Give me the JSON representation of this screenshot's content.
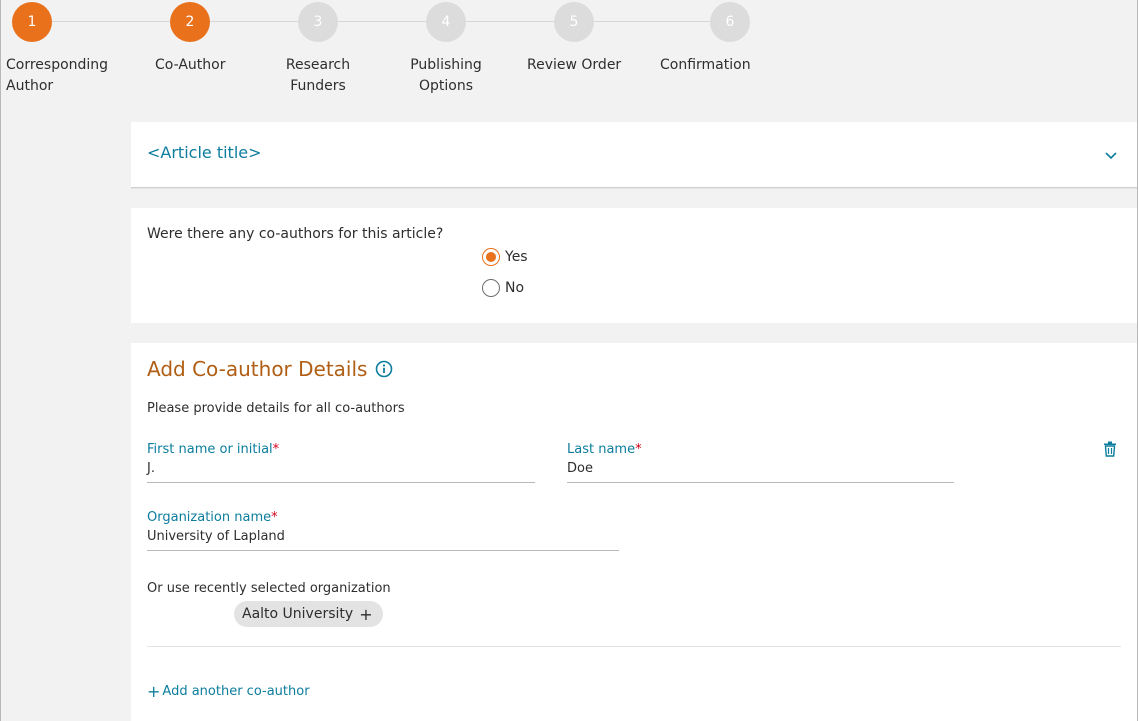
{
  "stepper": {
    "steps": [
      {
        "number": "1",
        "label_line1": "Corresponding",
        "label_line2": "Author"
      },
      {
        "number": "2",
        "label_line1": "Co-Author",
        "label_line2": ""
      },
      {
        "number": "3",
        "label_line1": "Research",
        "label_line2": "Funders"
      },
      {
        "number": "4",
        "label_line1": "Publishing",
        "label_line2": "Options"
      },
      {
        "number": "5",
        "label_line1": "Review Order",
        "label_line2": ""
      },
      {
        "number": "6",
        "label_line1": "Confirmation",
        "label_line2": ""
      }
    ],
    "active_color": "#e9711c",
    "inactive_color": "#dcdcdc"
  },
  "article": {
    "title": "<Article title>",
    "chevron_icon": "chevron-down-icon"
  },
  "coauthor_question": {
    "text": "Were there any co-authors for this article?",
    "options": [
      {
        "label": "Yes",
        "selected": true
      },
      {
        "label": "No",
        "selected": false
      }
    ]
  },
  "details": {
    "heading": "Add Co-author Details",
    "info_icon": "info-icon",
    "subtitle": "Please provide details for all co-authors",
    "first_name_label": "First name or initial",
    "first_name_value": "J.",
    "last_name_label": "Last name",
    "last_name_value": "Doe",
    "required_mark": "*",
    "organization_label": "Organization name",
    "organization_value": "University of Lapland",
    "recent_org_label": "Or use recently selected organization",
    "recent_org_chip": "Aalto University",
    "chip_plus": "+",
    "delete_icon": "trash-icon",
    "add_another_plus": "+",
    "add_another_label": "Add another co-author"
  },
  "colors": {
    "accent_orange": "#e9711c",
    "link_teal": "#0c7d9d",
    "heading_brown": "#b05e14",
    "required_red": "#d0021b"
  }
}
